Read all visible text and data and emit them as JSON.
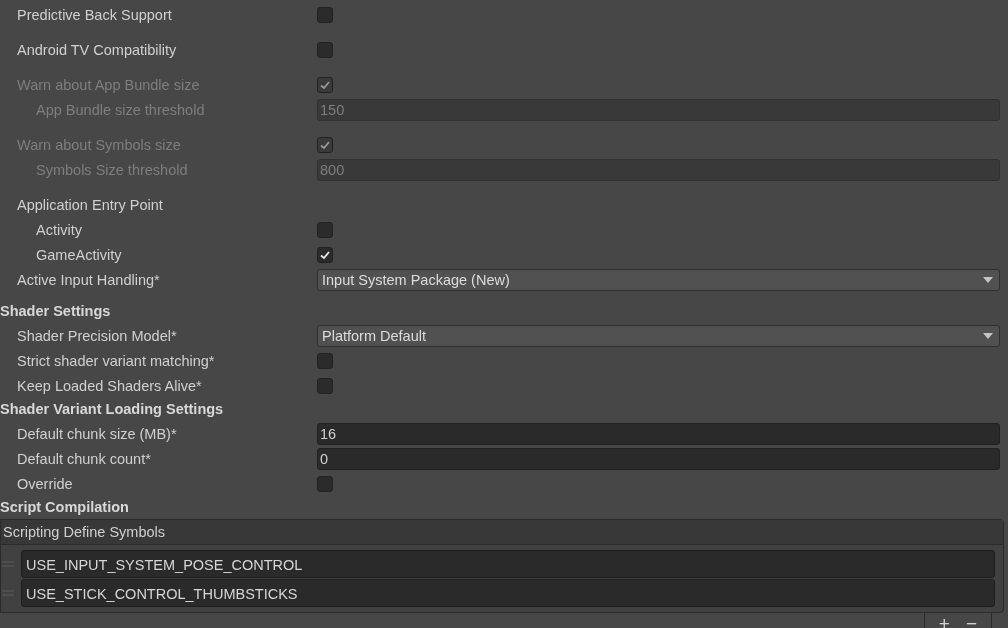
{
  "groups": [
    {
      "rows": [
        {
          "kind": "checkbox",
          "label": "Predictive Back Support",
          "checked": false,
          "disabled": false
        }
      ]
    },
    {
      "rows": [
        {
          "kind": "checkbox",
          "label": "Android TV Compatibility",
          "checked": false,
          "disabled": false
        }
      ]
    },
    {
      "rows": [
        {
          "kind": "checkbox",
          "label": "Warn about App Bundle size",
          "checked": true,
          "disabled": true,
          "children": [
            {
              "kind": "number",
              "label": "App Bundle size threshold",
              "value": "150",
              "disabled": true
            }
          ]
        }
      ]
    },
    {
      "rows": [
        {
          "kind": "checkbox",
          "label": "Warn about Symbols size",
          "checked": true,
          "disabled": true,
          "children": [
            {
              "kind": "number",
              "label": "Symbols Size threshold",
              "value": "800",
              "disabled": true
            }
          ]
        }
      ]
    },
    {
      "rows": [
        {
          "kind": "label",
          "label": "Application Entry Point",
          "disabled": false,
          "children": [
            {
              "kind": "checkbox",
              "label": "Activity",
              "checked": false,
              "disabled": false
            },
            {
              "kind": "checkbox",
              "label": "GameActivity",
              "checked": true,
              "disabled": false
            }
          ]
        },
        {
          "kind": "dropdown",
          "label": "Active Input Handling*",
          "value": "Input System Package (New)",
          "disabled": false
        }
      ]
    }
  ],
  "sections": [
    {
      "title": "Shader Settings",
      "rows": [
        {
          "kind": "dropdown",
          "label": "Shader Precision Model*",
          "value": "Platform Default",
          "disabled": false
        },
        {
          "kind": "checkbox",
          "label": "Strict shader variant matching*",
          "checked": false,
          "disabled": false
        },
        {
          "kind": "checkbox",
          "label": "Keep Loaded Shaders Alive*",
          "checked": false,
          "disabled": false
        }
      ]
    },
    {
      "title": "Shader Variant Loading Settings",
      "rows": [
        {
          "kind": "number",
          "label": "Default chunk size (MB)*",
          "value": "16",
          "disabled": false
        },
        {
          "kind": "number",
          "label": "Default chunk count*",
          "value": "0",
          "disabled": false
        },
        {
          "kind": "checkbox",
          "label": "Override",
          "checked": false,
          "disabled": false
        }
      ]
    },
    {
      "title": "Script Compilation"
    }
  ],
  "define_symbols": {
    "title": "Scripting Define Symbols",
    "items": [
      "USE_INPUT_SYSTEM_POSE_CONTROL",
      "USE_STICK_CONTROL_THUMBSTICKS"
    ],
    "add": "+",
    "remove": "−"
  }
}
